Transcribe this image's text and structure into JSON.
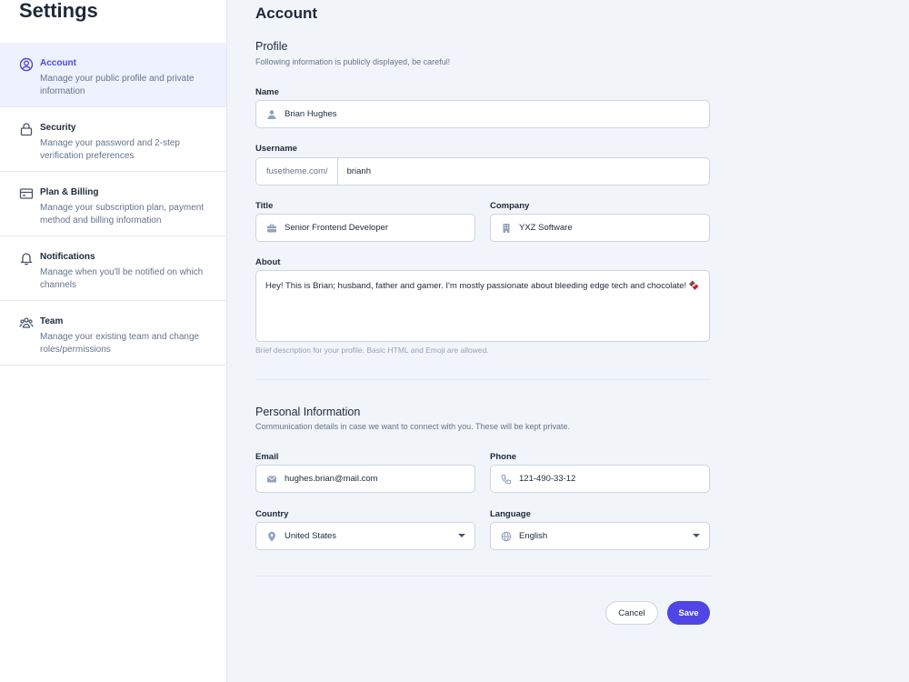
{
  "sidebar": {
    "title": "Settings",
    "items": [
      {
        "label": "Account",
        "desc": "Manage your public profile and private information",
        "icon": "user-circle-icon"
      },
      {
        "label": "Security",
        "desc": "Manage your password and 2-step verification preferences",
        "icon": "lock-icon"
      },
      {
        "label": "Plan & Billing",
        "desc": "Manage your subscription plan, payment method and billing information",
        "icon": "credit-card-icon"
      },
      {
        "label": "Notifications",
        "desc": "Manage when you'll be notified on which channels",
        "icon": "bell-icon"
      },
      {
        "label": "Team",
        "desc": "Manage your existing team and change roles/permissions",
        "icon": "users-icon"
      }
    ]
  },
  "main": {
    "title": "Account",
    "profile": {
      "title": "Profile",
      "subtitle": "Following information is publicly displayed, be careful!",
      "name_label": "Name",
      "name_value": "Brian Hughes",
      "username_label": "Username",
      "username_prefix": "fusetheme.com/",
      "username_value": "brianh",
      "title_label": "Title",
      "title_value": "Senior Frontend Developer",
      "company_label": "Company",
      "company_value": "YXZ Software",
      "about_label": "About",
      "about_value": "Hey! This is Brian; husband, father and gamer. I'm mostly passionate about bleeding edge tech and chocolate! 🍫",
      "about_hint": "Brief description for your profile. Basic HTML and Emoji are allowed."
    },
    "personal": {
      "title": "Personal Information",
      "subtitle": "Communication details in case we want to connect with you. These will be kept private.",
      "email_label": "Email",
      "email_value": "hughes.brian@mail.com",
      "phone_label": "Phone",
      "phone_value": "121-490-33-12",
      "country_label": "Country",
      "country_value": "United States",
      "language_label": "Language",
      "language_value": "English"
    },
    "actions": {
      "cancel_label": "Cancel",
      "save_label": "Save"
    }
  },
  "colors": {
    "accent": "#4f46e5",
    "active_bg": "#eef2ff",
    "page_bg": "#f1f5f9"
  }
}
